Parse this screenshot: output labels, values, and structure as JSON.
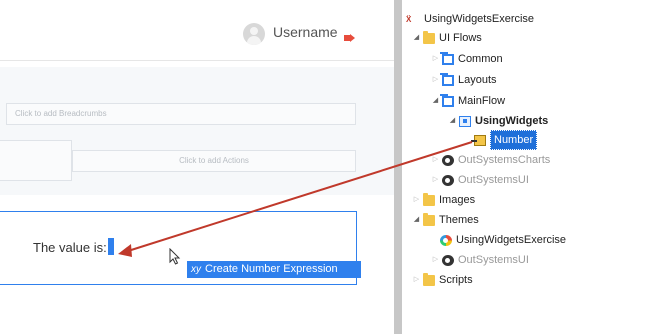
{
  "header": {
    "username": "Username",
    "avatar_icon": "user-avatar-icon",
    "logout_icon": "logout-icon",
    "logout_color": "#e74c3c"
  },
  "canvas": {
    "breadcrumbs_placeholder": "Click to add Breadcrumbs",
    "actions_placeholder": "Click to add Actions",
    "value_label": "The value is:",
    "expression_button": {
      "icon": "xy",
      "label": "Create Number Expression"
    },
    "accent_color": "#2f80ed"
  },
  "tree": {
    "app": {
      "label": "UsingWidgetsExercise",
      "icon": "app-icon"
    },
    "ui_flows": {
      "label": "UI Flows",
      "icon": "folder-icon"
    },
    "common": {
      "label": "Common",
      "icon": "flow-icon"
    },
    "layouts": {
      "label": "Layouts",
      "icon": "flow-icon"
    },
    "mainflow": {
      "label": "MainFlow",
      "icon": "flow-icon"
    },
    "using_widgets": {
      "label": "UsingWidgets",
      "icon": "screen-icon"
    },
    "number": {
      "label": "Number",
      "icon": "variable-icon"
    },
    "outsystems_charts": {
      "label": "OutSystemsCharts",
      "icon": "outsystems-icon"
    },
    "outsystems_ui": {
      "label": "OutSystemsUI",
      "icon": "outsystems-icon"
    },
    "images": {
      "label": "Images",
      "icon": "folder-icon"
    },
    "themes": {
      "label": "Themes",
      "icon": "folder-icon"
    },
    "theme_exercise": {
      "label": "UsingWidgetsExercise",
      "icon": "theme-icon"
    },
    "theme_outsystems_ui": {
      "label": "OutSystemsUI",
      "icon": "outsystems-icon"
    },
    "scripts": {
      "label": "Scripts",
      "icon": "folder-icon"
    },
    "selection_color": "#1e6fd9"
  },
  "annotation": {
    "arrow_color": "#c0392b"
  }
}
